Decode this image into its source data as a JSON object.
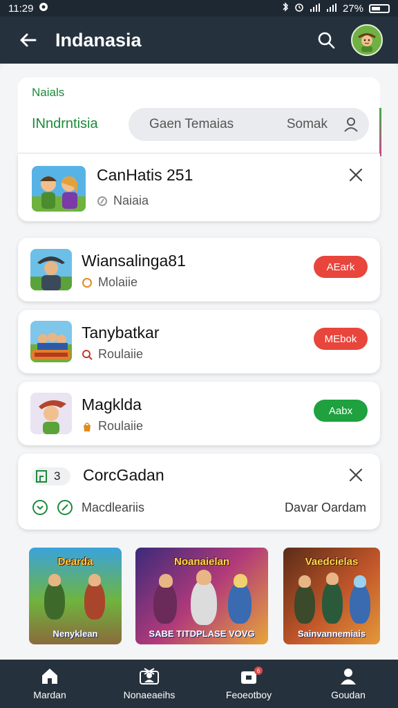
{
  "status_bar": {
    "time": "11:29",
    "battery_text": "27%"
  },
  "app_bar": {
    "title": "Indanasia"
  },
  "filter": {
    "label_small": "Naials",
    "region": "INndrntisia",
    "search_text": "Gaen Temaias",
    "sort_text": "Somak"
  },
  "active_item": {
    "name": "CanHatis 251",
    "subtitle": "Naiaia"
  },
  "list_items": [
    {
      "name": "Wiansalinga81",
      "subtitle": "Molaiie",
      "button_label": "AEark",
      "button_color": "#e8453c",
      "sub_icon_color": "#e08a1e"
    },
    {
      "name": "Tanybatkar",
      "subtitle": "Roulaiie",
      "button_label": "MEbok",
      "button_color": "#e8453c",
      "sub_icon_color": "#c0392b"
    },
    {
      "name": "Magklda",
      "subtitle": "Roulaiie",
      "button_label": "Aabx",
      "button_color": "#1ea13e",
      "sub_icon_color": "#e08a1e"
    }
  ],
  "summary": {
    "badge_count": "3",
    "title": "CorcGadan",
    "meta_label": "Macdleariis",
    "meta_right": "Davar Oardam"
  },
  "banners": [
    {
      "top_text": "Dearda",
      "bottom_text": "Nenyklean"
    },
    {
      "top_text": "Noanaielan",
      "bottom_text": "SABE TITDPLASE VOVG"
    },
    {
      "top_text": "Vaedcielas",
      "bottom_text": "Sainvannemiais"
    }
  ],
  "bottom_nav": [
    {
      "label": "Mardan",
      "icon": "home-icon"
    },
    {
      "label": "Nonaeaeihs",
      "icon": "profile-card-icon"
    },
    {
      "label": "Feoeotboy",
      "icon": "store-icon",
      "badge": "6"
    },
    {
      "label": "Goudan",
      "icon": "person-icon"
    }
  ],
  "colors": {
    "accent_green": "#1b8a3a",
    "bar_dark": "#25313d"
  }
}
